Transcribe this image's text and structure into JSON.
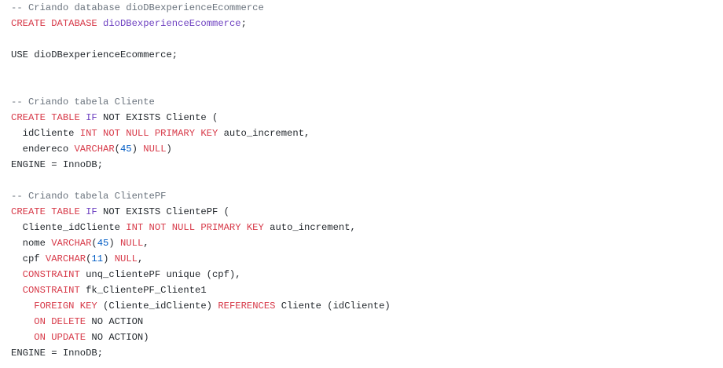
{
  "lines": [
    [
      {
        "t": "-- Criando database dioDBexperienceEcommerce",
        "k": "comment"
      }
    ],
    [
      {
        "t": "CREATE DATABASE",
        "k": "keyword"
      },
      {
        "t": " ",
        "k": "plain"
      },
      {
        "t": "dioDBexperienceEcommerce",
        "k": "name"
      },
      {
        "t": ";",
        "k": "plain"
      }
    ],
    [],
    [
      {
        "t": "USE dioDBexperienceEcommerce;",
        "k": "plain"
      }
    ],
    [],
    [],
    [
      {
        "t": "-- Criando tabela Cliente",
        "k": "comment"
      }
    ],
    [
      {
        "t": "CREATE TABLE",
        "k": "keyword"
      },
      {
        "t": " ",
        "k": "plain"
      },
      {
        "t": "IF",
        "k": "name"
      },
      {
        "t": " NOT EXISTS Cliente (",
        "k": "plain"
      }
    ],
    [
      {
        "t": "  idCliente ",
        "k": "plain"
      },
      {
        "t": "INT NOT NULL PRIMARY KEY",
        "k": "keyword"
      },
      {
        "t": " auto_increment,",
        "k": "plain"
      }
    ],
    [
      {
        "t": "  endereco ",
        "k": "plain"
      },
      {
        "t": "VARCHAR",
        "k": "keyword"
      },
      {
        "t": "(",
        "k": "plain"
      },
      {
        "t": "45",
        "k": "number"
      },
      {
        "t": ") ",
        "k": "plain"
      },
      {
        "t": "NULL",
        "k": "keyword"
      },
      {
        "t": ")",
        "k": "plain"
      }
    ],
    [
      {
        "t": "ENGINE = InnoDB;",
        "k": "plain"
      }
    ],
    [],
    [
      {
        "t": "-- Criando tabela ClientePF",
        "k": "comment"
      }
    ],
    [
      {
        "t": "CREATE TABLE",
        "k": "keyword"
      },
      {
        "t": " ",
        "k": "plain"
      },
      {
        "t": "IF",
        "k": "name"
      },
      {
        "t": " NOT EXISTS ClientePF (",
        "k": "plain"
      }
    ],
    [
      {
        "t": "  Cliente_idCliente ",
        "k": "plain"
      },
      {
        "t": "INT NOT NULL PRIMARY KEY",
        "k": "keyword"
      },
      {
        "t": " auto_increment,",
        "k": "plain"
      }
    ],
    [
      {
        "t": "  nome ",
        "k": "plain"
      },
      {
        "t": "VARCHAR",
        "k": "keyword"
      },
      {
        "t": "(",
        "k": "plain"
      },
      {
        "t": "45",
        "k": "number"
      },
      {
        "t": ") ",
        "k": "plain"
      },
      {
        "t": "NULL",
        "k": "keyword"
      },
      {
        "t": ",",
        "k": "plain"
      }
    ],
    [
      {
        "t": "  cpf ",
        "k": "plain"
      },
      {
        "t": "VARCHAR",
        "k": "keyword"
      },
      {
        "t": "(",
        "k": "plain"
      },
      {
        "t": "11",
        "k": "number"
      },
      {
        "t": ") ",
        "k": "plain"
      },
      {
        "t": "NULL",
        "k": "keyword"
      },
      {
        "t": ",",
        "k": "plain"
      }
    ],
    [
      {
        "t": "  ",
        "k": "plain"
      },
      {
        "t": "CONSTRAINT",
        "k": "keyword"
      },
      {
        "t": " unq_clientePF unique (cpf),",
        "k": "plain"
      }
    ],
    [
      {
        "t": "  ",
        "k": "plain"
      },
      {
        "t": "CONSTRAINT",
        "k": "keyword"
      },
      {
        "t": " fk_ClientePF_Cliente1",
        "k": "plain"
      }
    ],
    [
      {
        "t": "    ",
        "k": "plain"
      },
      {
        "t": "FOREIGN KEY",
        "k": "keyword"
      },
      {
        "t": " (Cliente_idCliente) ",
        "k": "plain"
      },
      {
        "t": "REFERENCES",
        "k": "keyword"
      },
      {
        "t": " Cliente (idCliente)",
        "k": "plain"
      }
    ],
    [
      {
        "t": "    ",
        "k": "plain"
      },
      {
        "t": "ON DELETE",
        "k": "keyword"
      },
      {
        "t": " NO ACTION",
        "k": "plain"
      }
    ],
    [
      {
        "t": "    ",
        "k": "plain"
      },
      {
        "t": "ON UPDATE",
        "k": "keyword"
      },
      {
        "t": " NO ACTION)",
        "k": "plain"
      }
    ],
    [
      {
        "t": "ENGINE = InnoDB;",
        "k": "plain"
      }
    ]
  ],
  "colors": {
    "comment": "#6a737d",
    "keyword": "#d73a49",
    "name": "#6f42c1",
    "number": "#005cc5",
    "plain": "#24292e",
    "background": "#ffffff"
  }
}
